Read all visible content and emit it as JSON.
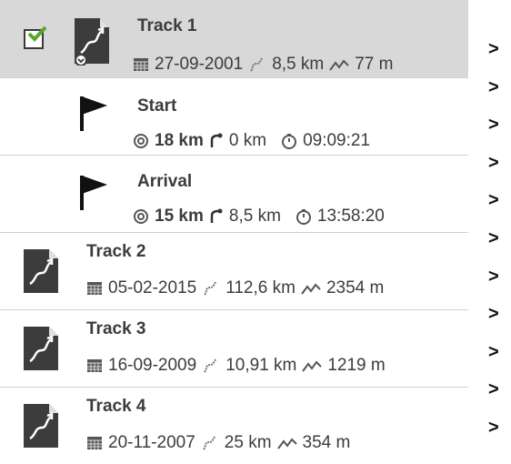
{
  "tracks": [
    {
      "title": "Track 1",
      "date": "27-09-2001",
      "distance": "8,5 km",
      "elevation": "77 m"
    },
    {
      "title": "Track 2",
      "date": "05-02-2015",
      "distance": "112,6 km",
      "elevation": "2354 m"
    },
    {
      "title": "Track 3",
      "date": "16-09-2009",
      "distance": "10,91 km",
      "elevation": "1219 m"
    },
    {
      "title": "Track 4",
      "date": "20-11-2007",
      "distance": "25 km",
      "elevation": "354 m"
    }
  ],
  "waypoints": [
    {
      "title": "Start",
      "dist": "18 km",
      "route": "0 km",
      "time": "09:09:21"
    },
    {
      "title": "Arrival",
      "dist": "15 km",
      "route": "8,5 km",
      "time": "13:58:20"
    }
  ],
  "arrows": [
    ">",
    ">",
    ">",
    ">",
    ">",
    ">",
    ">",
    ">",
    ">",
    ">",
    ">"
  ],
  "colors": {
    "selected_bg": "#d8d8d8",
    "icon_bg": "#3c3c3c",
    "check": "#5aa62e"
  },
  "icons": [
    "checkbox-checked-icon",
    "track-icon",
    "flag-icon",
    "calendar-icon",
    "route-distance-icon",
    "elevation-icon",
    "distance-target-icon",
    "route-start-icon",
    "timer-icon",
    "chevron-right-icon"
  ]
}
